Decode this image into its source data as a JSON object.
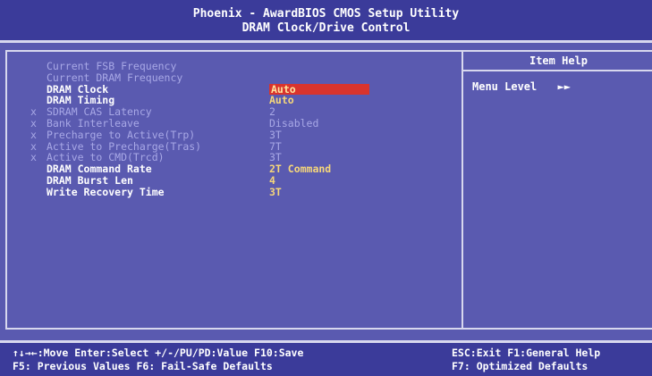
{
  "header": {
    "title": "Phoenix - AwardBIOS CMOS Setup Utility",
    "subtitle": "DRAM Clock/Drive Control"
  },
  "settings": [
    {
      "label": "Current FSB Frequency",
      "value": "",
      "state": "info",
      "mark": ""
    },
    {
      "label": "Current DRAM Frequency",
      "value": "",
      "state": "info",
      "mark": ""
    },
    {
      "label": "DRAM Clock",
      "value": "Auto",
      "state": "selected",
      "mark": ""
    },
    {
      "label": "DRAM Timing",
      "value": "Auto",
      "state": "active",
      "mark": ""
    },
    {
      "label": "SDRAM CAS Latency",
      "value": "2",
      "state": "disabled",
      "mark": "x"
    },
    {
      "label": "Bank Interleave",
      "value": "Disabled",
      "state": "disabled",
      "mark": "x"
    },
    {
      "label": "Precharge to Active(Trp)",
      "value": "3T",
      "state": "disabled",
      "mark": "x"
    },
    {
      "label": "Active to Precharge(Tras)",
      "value": "7T",
      "state": "disabled",
      "mark": "x"
    },
    {
      "label": "Active to CMD(Trcd)",
      "value": "3T",
      "state": "disabled",
      "mark": "x"
    },
    {
      "label": "DRAM Command Rate",
      "value": "2T Command",
      "state": "active",
      "mark": ""
    },
    {
      "label": "DRAM Burst Len",
      "value": "4",
      "state": "active",
      "mark": ""
    },
    {
      "label": "Write Recovery Time",
      "value": "3T",
      "state": "active",
      "mark": ""
    }
  ],
  "help": {
    "title": "Item Help",
    "menu_level_label": "Menu Level",
    "menu_level_arrows": "►►"
  },
  "footer": {
    "line1_left": "↑↓→←:Move  Enter:Select  +/-/PU/PD:Value  F10:Save",
    "line2_left": "  F5: Previous Values    F6: Fail-Safe Defaults",
    "line1_right": "ESC:Exit  F1:General Help",
    "line2_right": "F7: Optimized Defaults"
  },
  "colors": {
    "background": "#5a5ab0",
    "highlight": "#d9342d",
    "value_text": "#f6d77a",
    "disabled_text": "#a8a8e6"
  }
}
